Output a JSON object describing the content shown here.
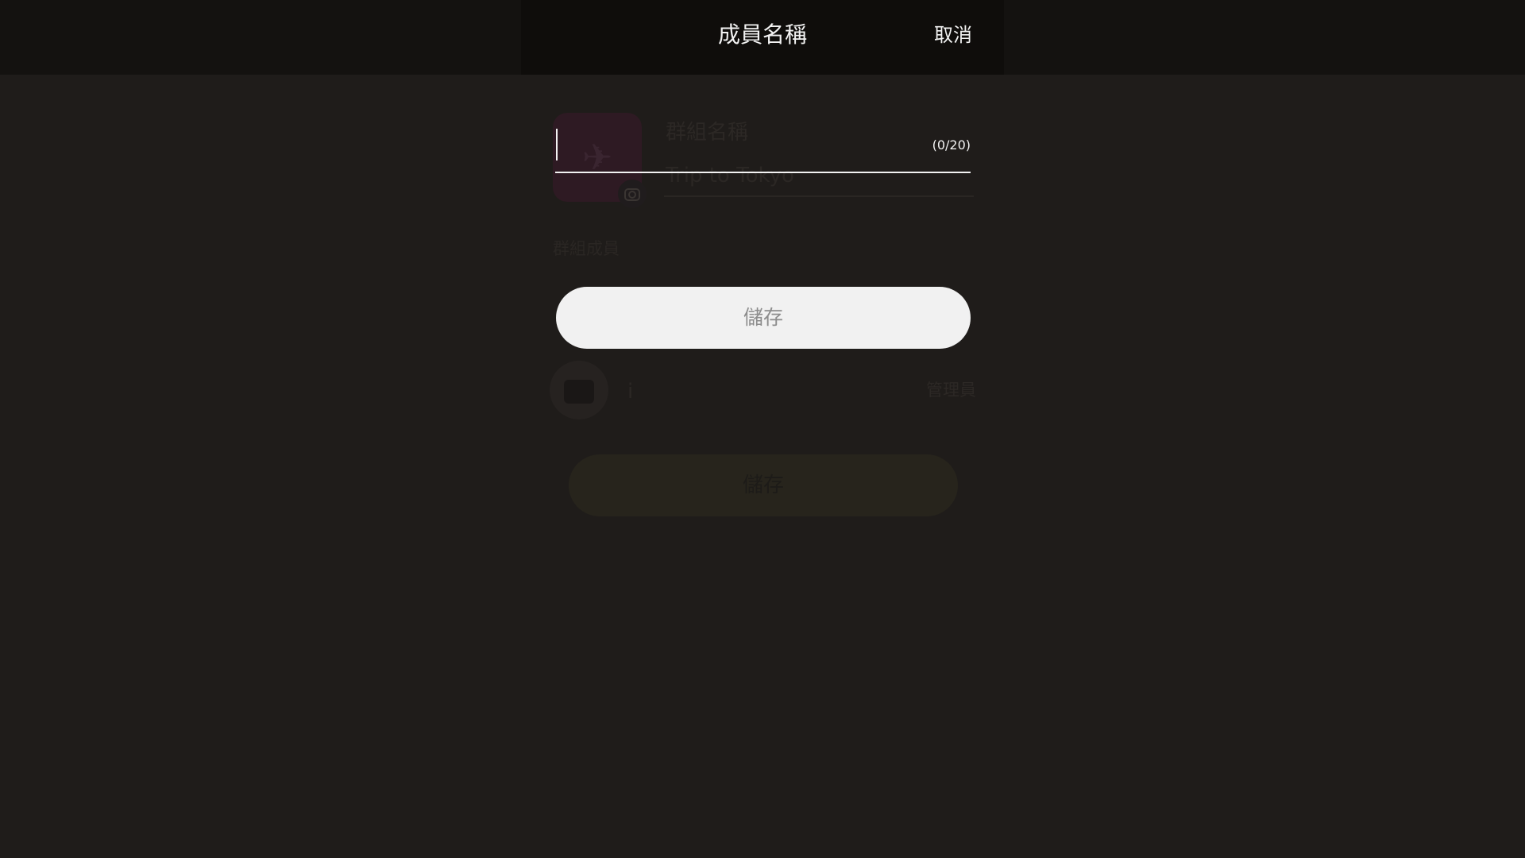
{
  "header": {
    "title": "成員名稱",
    "cancel_label": "取消"
  },
  "name_input": {
    "value": "",
    "counter": "(0/20)"
  },
  "save_button": {
    "label": "儲存",
    "background": "#f1f1f1",
    "text_color": "#8c8c8c"
  },
  "background_content": {
    "group_name_label": "群組名稱",
    "group_name_value": "Trip to Tokyo",
    "members_label": "群組成員",
    "member": {
      "name": "i",
      "role": "管理員"
    },
    "save_label": "儲存",
    "group_avatar_icon": "airplane-icon",
    "camera_icon": "camera-icon"
  },
  "colors": {
    "page_background": "#1f1c1a",
    "header_background": "#0f0d0b",
    "text": "#f2f2f2",
    "avatar_accent": "#2e1a23"
  }
}
